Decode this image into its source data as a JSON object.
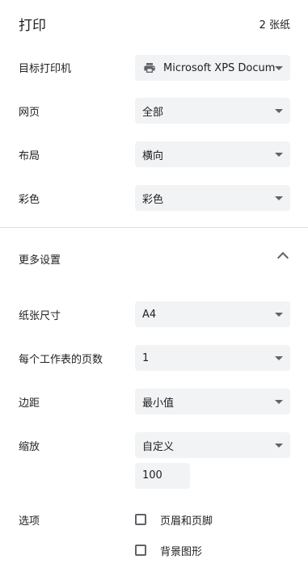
{
  "header": {
    "title": "打印",
    "sheets": "2 张纸"
  },
  "settings": {
    "printer": {
      "label": "目标打印机",
      "value": "Microsoft XPS Docum"
    },
    "pages": {
      "label": "网页",
      "value": "全部"
    },
    "layout": {
      "label": "布局",
      "value": "横向"
    },
    "color": {
      "label": "彩色",
      "value": "彩色"
    }
  },
  "more": {
    "label": "更多设置"
  },
  "advanced": {
    "paper": {
      "label": "纸张尺寸",
      "value": "A4"
    },
    "pages_per_sheet": {
      "label": "每个工作表的页数",
      "value": "1"
    },
    "margins": {
      "label": "边距",
      "value": "最小值"
    },
    "scale": {
      "label": "缩放",
      "value": "自定义",
      "custom_value": "100"
    },
    "options": {
      "label": "选项",
      "headers_footers": {
        "label": "页眉和页脚",
        "checked": false
      },
      "background_graphics": {
        "label": "背景图形",
        "checked": false
      }
    }
  }
}
